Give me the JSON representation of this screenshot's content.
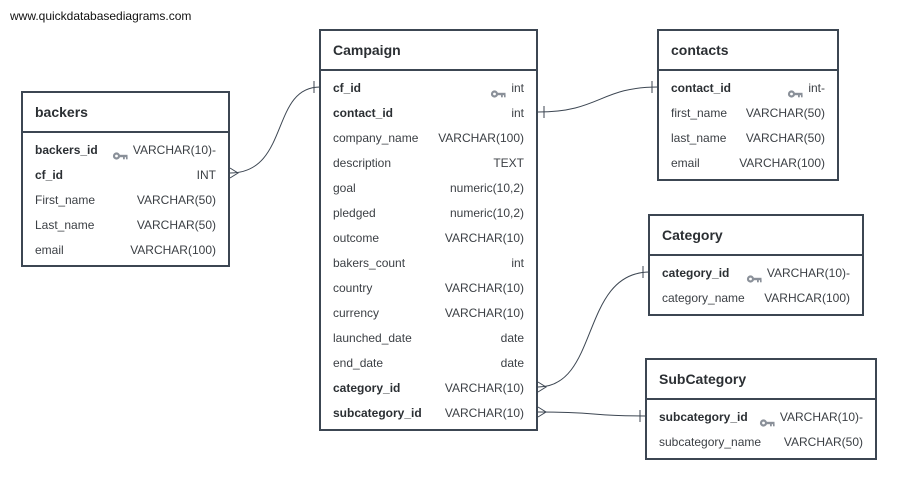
{
  "site_url": "www.quickdatabasediagrams.com",
  "tables": {
    "campaign": {
      "title": "Campaign",
      "columns": [
        {
          "name": "cf_id",
          "type": "int",
          "pk": true
        },
        {
          "name": "contact_id",
          "type": "int",
          "fk": true
        },
        {
          "name": "company_name",
          "type": "VARCHAR(100)"
        },
        {
          "name": "description",
          "type": "TEXT"
        },
        {
          "name": "goal",
          "type": "numeric(10,2)"
        },
        {
          "name": "pledged",
          "type": "numeric(10,2)"
        },
        {
          "name": "outcome",
          "type": "VARCHAR(10)"
        },
        {
          "name": "bakers_count",
          "type": "int"
        },
        {
          "name": "country",
          "type": "VARCHAR(10)"
        },
        {
          "name": "currency",
          "type": "VARCHAR(10)"
        },
        {
          "name": "launched_date",
          "type": "date"
        },
        {
          "name": "end_date",
          "type": "date"
        },
        {
          "name": "category_id",
          "type": "VARCHAR(10)",
          "fk": true
        },
        {
          "name": "subcategory_id",
          "type": "VARCHAR(10)",
          "fk": true
        }
      ]
    },
    "backers": {
      "title": "backers",
      "columns": [
        {
          "name": "backers_id",
          "type": "VARCHAR(10)-",
          "pk": true
        },
        {
          "name": "cf_id",
          "type": "INT",
          "fk": true
        },
        {
          "name": "First_name",
          "type": "VARCHAR(50)"
        },
        {
          "name": "Last_name",
          "type": "VARCHAR(50)"
        },
        {
          "name": "email",
          "type": "VARCHAR(100)"
        }
      ]
    },
    "contacts": {
      "title": "contacts",
      "columns": [
        {
          "name": "contact_id",
          "type": "int-",
          "pk": true
        },
        {
          "name": "first_name",
          "type": "VARCHAR(50)"
        },
        {
          "name": "last_name",
          "type": "VARCHAR(50)"
        },
        {
          "name": "email",
          "type": "VARCHAR(100)"
        }
      ]
    },
    "category": {
      "title": "Category",
      "columns": [
        {
          "name": "category_id",
          "type": "VARCHAR(10)-",
          "pk": true
        },
        {
          "name": "category_name",
          "type": "VARHCAR(100)"
        }
      ]
    },
    "subcategory": {
      "title": "SubCategory",
      "columns": [
        {
          "name": "subcategory_id",
          "type": "VARCHAR(10)-",
          "pk": true
        },
        {
          "name": "subcategory_name",
          "type": "VARCHAR(50)"
        }
      ]
    }
  }
}
